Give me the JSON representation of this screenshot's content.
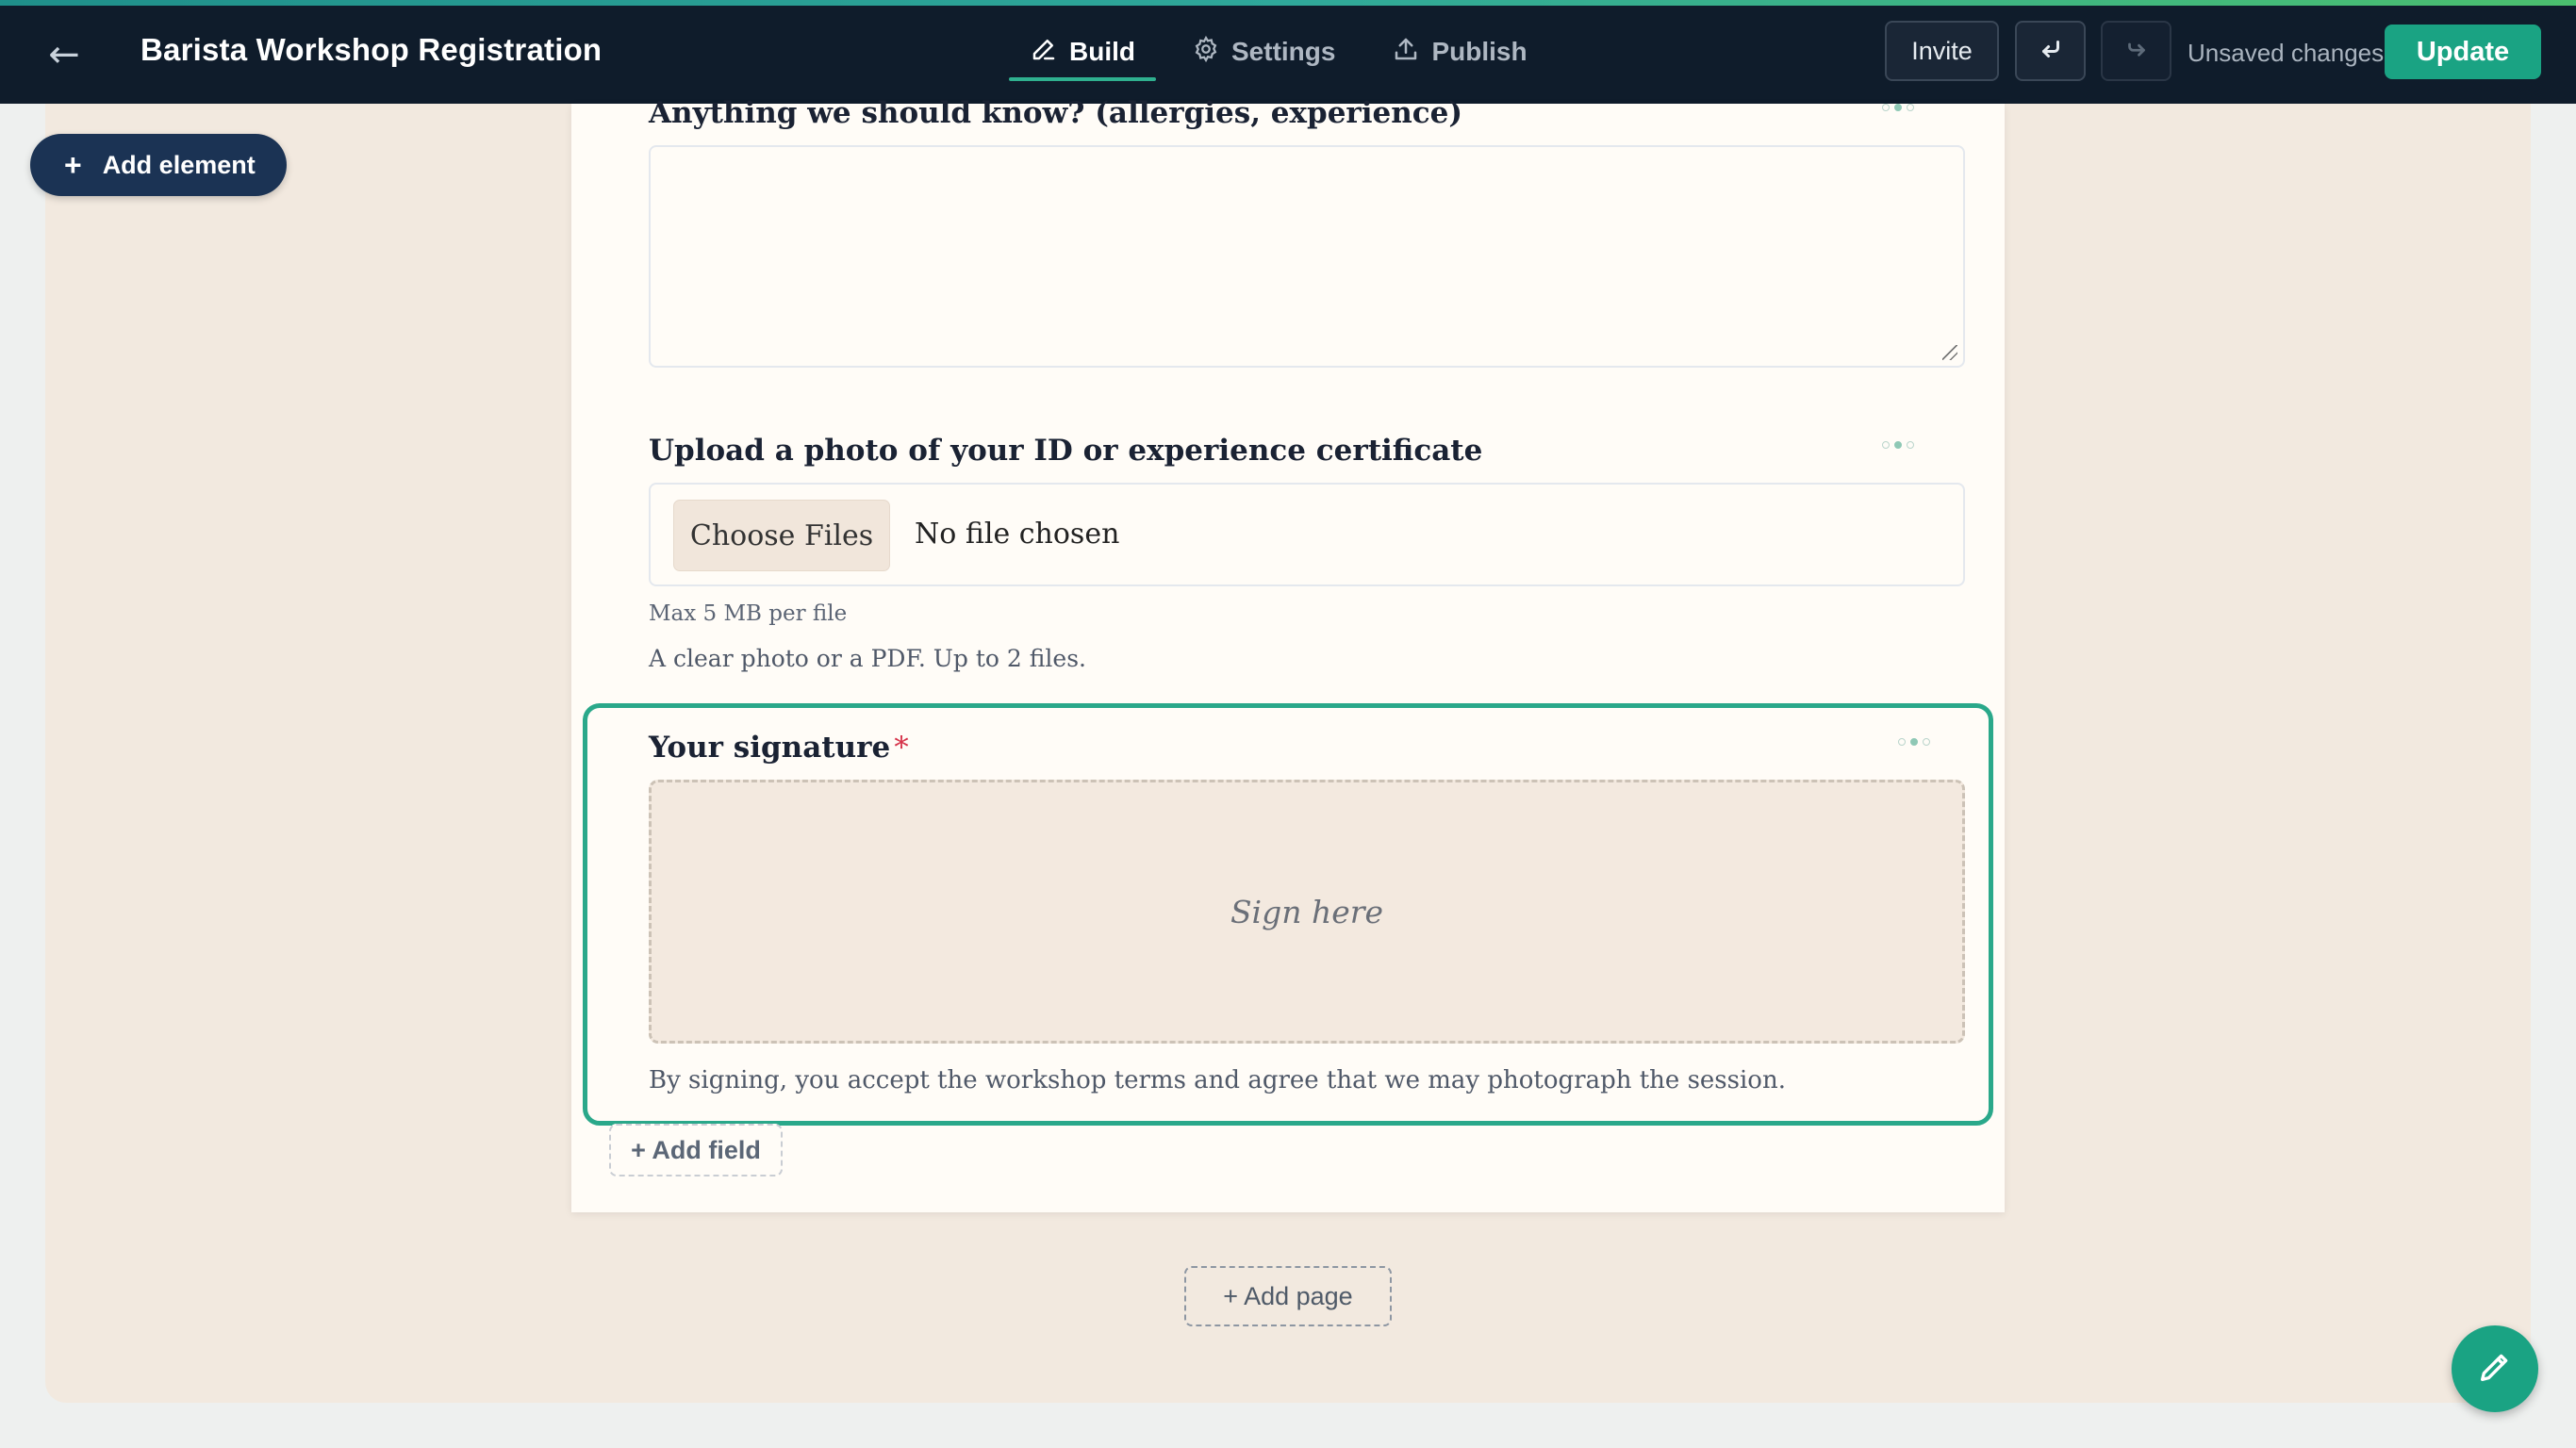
{
  "header": {
    "back_icon": "arrow-left-icon",
    "title": "Barista Workshop Registration",
    "tabs": [
      {
        "label": "Build",
        "icon": "pencil-icon",
        "active": true
      },
      {
        "label": "Settings",
        "icon": "gear-icon",
        "active": false
      },
      {
        "label": "Publish",
        "icon": "upload-icon",
        "active": false
      }
    ],
    "invite_label": "Invite",
    "undo_icon": "undo-icon",
    "redo_icon": "redo-icon",
    "status_text": "Unsaved changes",
    "update_label": "Update"
  },
  "toolbar": {
    "add_element_label": "Add element",
    "add_element_icon": "plus-icon"
  },
  "form": {
    "fields": [
      {
        "type": "textarea",
        "label": "Anything we should know? (allergies, experience)",
        "value": ""
      },
      {
        "type": "file",
        "label": "Upload a photo of your ID or experience certificate",
        "button_label": "Choose Files",
        "status_text": "No file chosen",
        "hint": "Max 5 MB per file",
        "help": "A clear photo or a PDF. Up to 2 files."
      },
      {
        "type": "signature",
        "label": "Your signature",
        "required_marker": "*",
        "placeholder": "Sign here",
        "help": "By signing, you accept the workshop terms and agree that we may photograph the session.",
        "selected": true
      }
    ],
    "add_field_label": "+ Add field",
    "add_page_label": "+ Add page"
  },
  "fab": {
    "icon": "pencil-icon"
  },
  "colors": {
    "topbar": "#0f1c2b",
    "accent": "#1aa383",
    "canvas": "#f2e9df",
    "card": "#fffcf7",
    "selection_border": "#2aa88a",
    "required": "#d6334a",
    "add_element_bg": "#1b3354"
  }
}
